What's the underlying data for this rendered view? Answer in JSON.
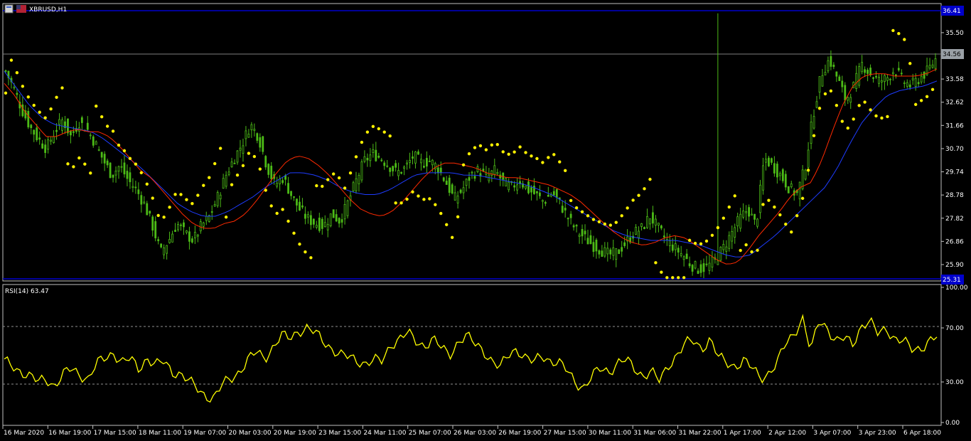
{
  "window": {
    "symbol_title": "XBRUSD,H1",
    "rsi_title": "RSI(14) 63.47"
  },
  "colors": {
    "background": "#000000",
    "candle": "#4CBB17",
    "ma_fast": "#FF2A00",
    "ma_slow": "#1E3CFF",
    "sar": "#FFF200",
    "rsi_line": "#FFFF00",
    "hline_blue": "#0000CC",
    "grid_gray": "#808080",
    "text": "#FFFFFF"
  },
  "price_axis": {
    "labels": [
      "36.41",
      "35.50",
      "34.56",
      "33.58",
      "32.62",
      "31.66",
      "30.70",
      "29.74",
      "28.78",
      "27.82",
      "26.86",
      "25.90",
      "25.31"
    ],
    "current_price_label": "34.56",
    "top_marker_label": "36.41",
    "bottom_marker_label": "25.31"
  },
  "rsi_axis": {
    "labels": [
      "100.00",
      "70.00",
      "30.00",
      "0.00"
    ]
  },
  "time_axis": {
    "labels": [
      "16 Mar 2020",
      "16 Mar 19:00",
      "17 Mar 15:00",
      "18 Mar 11:00",
      "19 Mar 07:00",
      "20 Mar 03:00",
      "20 Mar 19:00",
      "23 Mar 15:00",
      "24 Mar 11:00",
      "25 Mar 07:00",
      "26 Mar 03:00",
      "26 Mar 19:00",
      "27 Mar 15:00",
      "30 Mar 11:00",
      "31 Mar 06:00",
      "31 Mar 22:00",
      "1 Apr 17:00",
      "2 Apr 12:00",
      "3 Apr 07:00",
      "3 Apr 23:00",
      "6 Apr 18:00"
    ]
  },
  "chart_data": [
    {
      "type": "candlestick",
      "title": "XBRUSD,H1",
      "ylim": [
        25.31,
        36.41
      ],
      "price_path": [
        33.9,
        33.2,
        32.3,
        31.6,
        31.1,
        30.7,
        31.4,
        31.9,
        31.2,
        31.8,
        31.5,
        30.9,
        30.2,
        29.6,
        30.0,
        29.4,
        29.0,
        28.4,
        27.5,
        26.4,
        26.9,
        27.6,
        27.2,
        26.9,
        27.5,
        27.9,
        28.7,
        29.6,
        30.3,
        30.9,
        31.7,
        31.2,
        30.0,
        29.2,
        29.5,
        28.8,
        28.2,
        27.8,
        27.6,
        27.5,
        28.0,
        27.7,
        28.5,
        29.4,
        30.2,
        30.5,
        30.3,
        30.0,
        29.7,
        29.9,
        30.4,
        30.1,
        30.2,
        29.9,
        29.3,
        28.6,
        29.0,
        29.6,
        29.8,
        29.5,
        29.8,
        29.3,
        29.1,
        29.4,
        29.0,
        28.8,
        28.5,
        28.9,
        28.4,
        27.8,
        27.3,
        27.0,
        26.7,
        26.5,
        26.3,
        26.4,
        26.8,
        27.2,
        27.4,
        27.9,
        27.4,
        26.9,
        26.6,
        26.3,
        25.9,
        25.7,
        25.8,
        26.1,
        26.6,
        27.2,
        27.8,
        28.2,
        27.5,
        30.3,
        30.0,
        29.6,
        29.1,
        28.8,
        29.9,
        32.1,
        33.8,
        34.4,
        33.6,
        32.7,
        33.3,
        34.2,
        33.8,
        33.5,
        33.6,
        34.0,
        33.5,
        33.3,
        33.6,
        33.9,
        34.4
      ],
      "ma_fast_path": [
        33.4,
        32.9,
        32.2,
        31.7,
        31.2,
        31.2,
        31.4,
        31.5,
        31.4,
        31.4,
        31.2,
        30.8,
        30.3,
        29.8,
        29.5,
        29.0,
        28.5,
        28.0,
        27.6,
        27.4,
        27.4,
        27.6,
        27.7,
        28.0,
        28.5,
        29.1,
        29.7,
        30.2,
        30.4,
        30.3,
        30.0,
        29.6,
        29.1,
        28.6,
        28.2,
        28.0,
        27.9,
        28.1,
        28.5,
        29.0,
        29.5,
        29.9,
        30.1,
        30.1,
        30.0,
        29.9,
        29.7,
        29.6,
        29.5,
        29.5,
        29.4,
        29.3,
        29.2,
        29.0,
        28.8,
        28.5,
        28.1,
        27.7,
        27.3,
        27.0,
        26.8,
        26.7,
        26.8,
        27.0,
        27.1,
        27.0,
        26.7,
        26.4,
        26.1,
        25.9,
        26.0,
        26.5,
        27.1,
        27.6,
        28.1,
        28.7,
        29.1,
        29.3,
        30.2,
        31.4,
        32.5,
        33.3,
        33.7,
        33.8,
        33.8,
        33.7,
        33.7,
        33.7,
        33.8,
        34.0
      ],
      "ma_slow_path": [
        33.9,
        33.2,
        32.5,
        32.0,
        31.7,
        31.6,
        31.5,
        31.4,
        31.1,
        30.7,
        30.3,
        29.9,
        29.4,
        28.9,
        28.4,
        28.1,
        27.9,
        27.9,
        28.1,
        28.4,
        28.7,
        29.1,
        29.4,
        29.7,
        29.7,
        29.6,
        29.4,
        29.1,
        28.9,
        28.8,
        28.8,
        29.0,
        29.3,
        29.6,
        29.7,
        29.7,
        29.7,
        29.6,
        29.6,
        29.5,
        29.4,
        29.3,
        29.2,
        29.0,
        28.8,
        28.5,
        28.2,
        27.9,
        27.6,
        27.3,
        27.1,
        27.0,
        26.9,
        26.9,
        26.9,
        26.8,
        26.7,
        26.5,
        26.3,
        26.2,
        26.3,
        26.7,
        27.1,
        27.6,
        28.1,
        28.6,
        29.1,
        29.9,
        30.9,
        31.8,
        32.4,
        32.9,
        33.1,
        33.2,
        33.3,
        33.5
      ]
    },
    {
      "type": "line",
      "title": "RSI(14) 63.47",
      "ylim": [
        0,
        100
      ],
      "series": [
        {
          "name": "RSI(14)",
          "values": [
            45,
            42,
            38,
            34,
            30,
            33,
            27,
            35,
            40,
            36,
            32,
            43,
            48,
            52,
            44,
            47,
            40,
            48,
            42,
            45,
            38,
            36,
            30,
            25,
            20,
            18,
            28,
            33,
            38,
            46,
            52,
            48,
            56,
            64,
            62,
            68,
            70,
            66,
            60,
            55,
            50,
            48,
            46,
            44,
            46,
            45,
            58,
            62,
            66,
            60,
            57,
            62,
            55,
            50,
            60,
            64,
            58,
            54,
            46,
            40,
            50,
            55,
            48,
            44,
            50,
            46,
            44,
            38,
            30,
            26,
            34,
            40,
            38,
            44,
            46,
            40,
            35,
            38,
            30,
            42,
            50,
            58,
            60,
            55,
            62,
            48,
            44,
            42,
            46,
            40,
            33,
            37,
            44,
            58,
            66,
            78,
            52,
            76,
            70,
            60,
            62,
            58,
            72,
            75,
            65,
            70,
            62,
            60,
            54,
            55,
            60,
            63
          ]
        }
      ],
      "reference_levels": [
        70,
        30
      ]
    }
  ]
}
